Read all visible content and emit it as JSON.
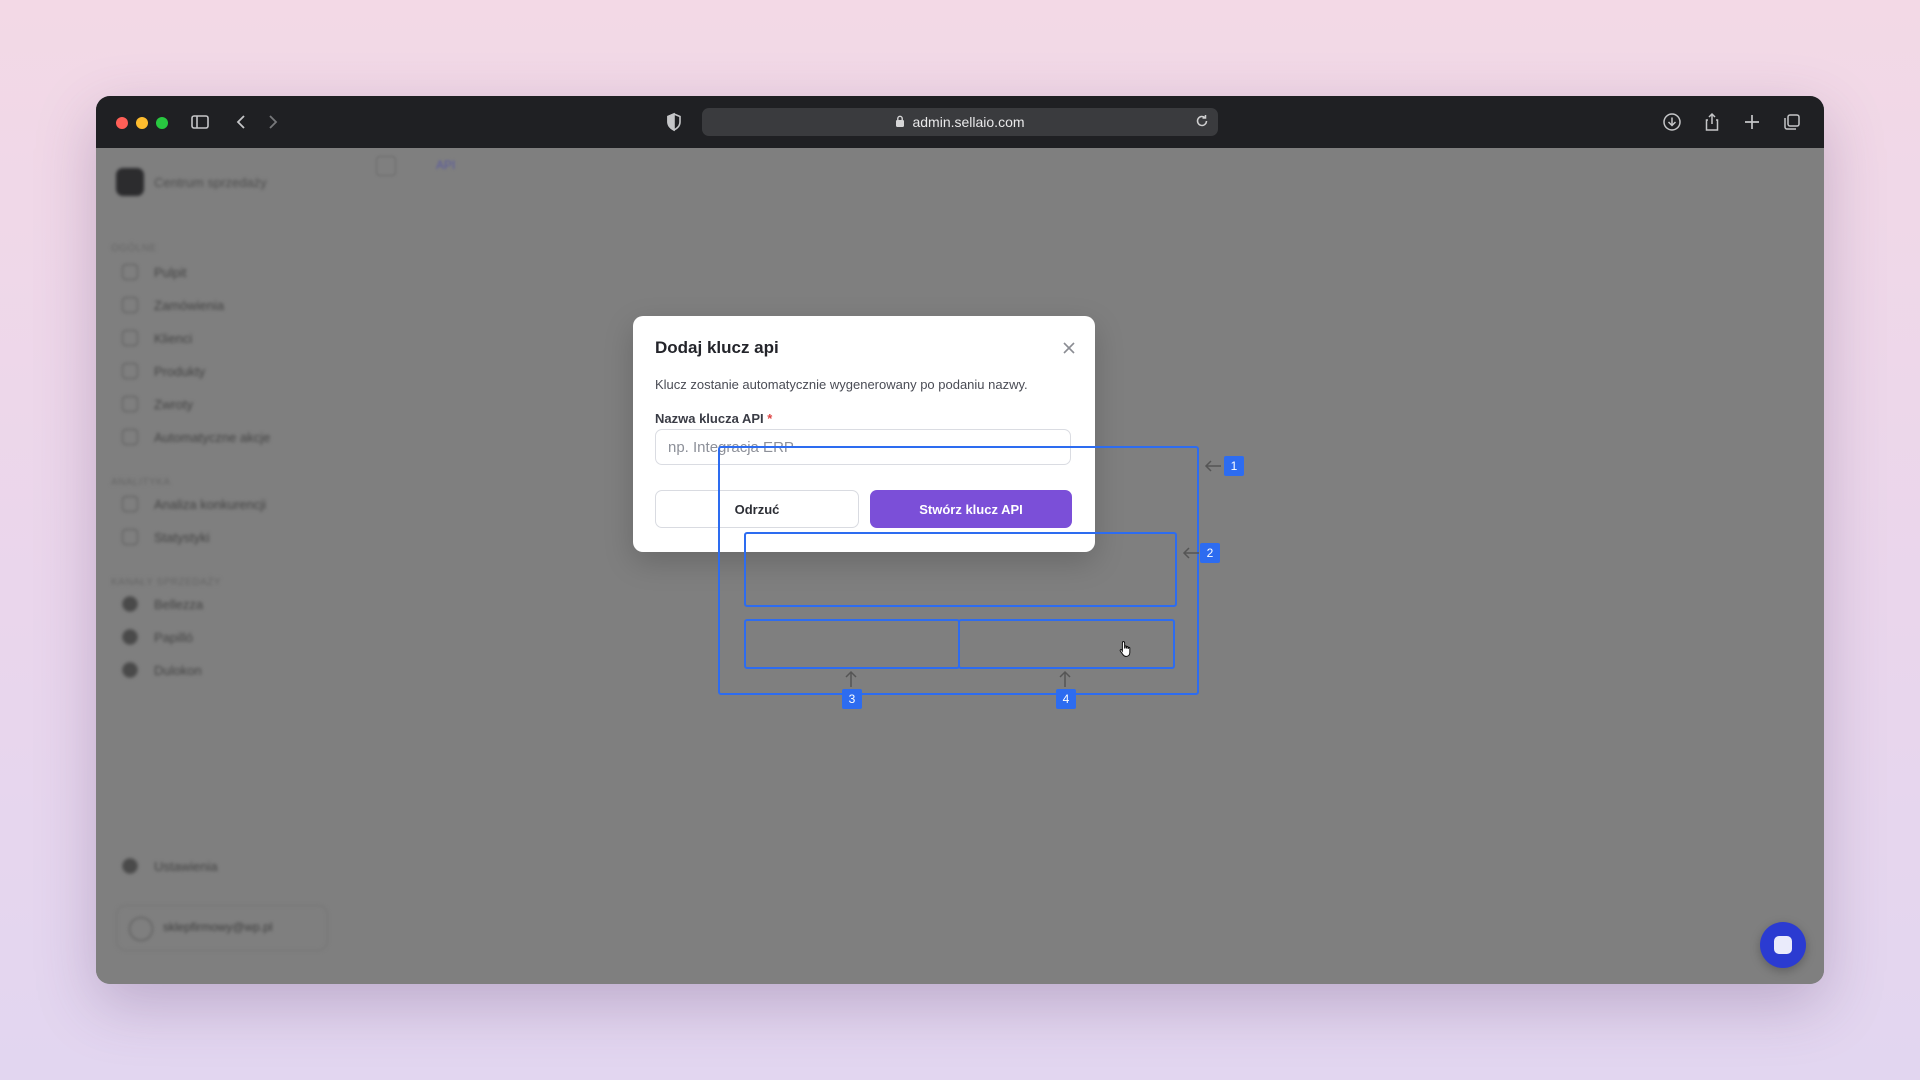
{
  "browser": {
    "url": "admin.sellaio.com",
    "traffic_lights": [
      "#ff5f57",
      "#febc2e",
      "#28c840"
    ]
  },
  "sidebar": {
    "app_name": "Centrum sprzedaży",
    "sections": [
      {
        "title": "OGÓLNE",
        "items": [
          "Pulpit",
          "Zamówienia",
          "Klienci",
          "Produkty",
          "Zwroty",
          "Automatyczne akcje"
        ]
      },
      {
        "title": "ANALITYKA",
        "items": [
          "Analiza konkurencji",
          "Statystyki"
        ]
      },
      {
        "title": "KANAŁY SPRZEDAŻY",
        "items": [
          "Bellezza",
          "Papilló",
          "Dulokon"
        ]
      }
    ],
    "settings_label": "Ustawienia",
    "user_email": "sklepfirmowy@wp.pl"
  },
  "breadcrumb": {
    "current": "API"
  },
  "modal": {
    "title": "Dodaj klucz api",
    "description": "Klucz zostanie automatycznie wygenerowany po podaniu nazwy.",
    "field_label": "Nazwa klucza API",
    "required_mark": "*",
    "field_placeholder": "np. Integracja ERP",
    "field_value": "",
    "cancel_label": "Odrzuć",
    "submit_label": "Stwórz klucz API"
  },
  "annotations": {
    "badges": [
      "1",
      "2",
      "3",
      "4"
    ],
    "color": "#2d6cf0"
  },
  "colors": {
    "primary": "#7b4fd8",
    "overlay": "#808080"
  }
}
